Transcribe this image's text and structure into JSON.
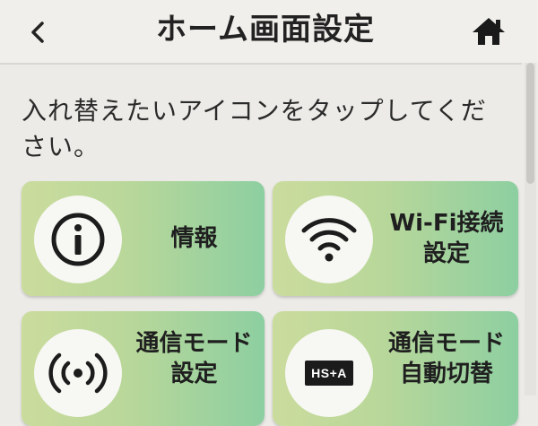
{
  "header": {
    "title": "ホーム画面設定",
    "back_icon": "chevron-left-icon",
    "home_icon": "home-icon"
  },
  "instruction": "入れ替えたいアイコンをタップしてください。",
  "tiles": [
    {
      "label": "情報",
      "icon": "info-icon"
    },
    {
      "label": "Wi-Fi接続\n設定",
      "icon": "wifi-icon"
    },
    {
      "label": "通信モード\n設定",
      "icon": "broadcast-icon"
    },
    {
      "label": "通信モード\n自動切替",
      "icon": "hs-a-icon",
      "icon_text": "HS+A"
    }
  ],
  "colors": {
    "background": "#ecebe7",
    "tile_gradient_start": "#cbdc9d",
    "tile_gradient_end": "#8dcfa1"
  }
}
